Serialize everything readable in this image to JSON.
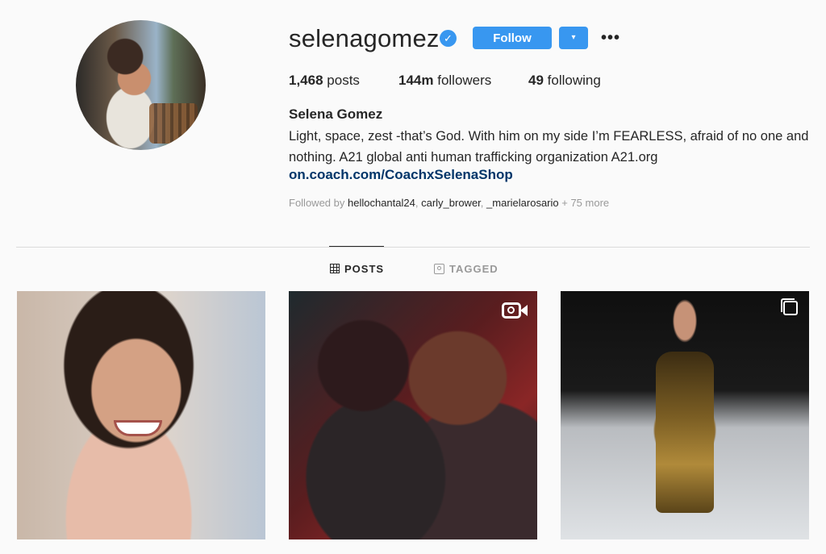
{
  "profile": {
    "username": "selenagomez",
    "verified_mark": "✓",
    "follow_label": "Follow",
    "dropdown_icon": "▾",
    "more_label": "•••",
    "stats": {
      "posts_count": "1,468",
      "posts_label": "posts",
      "followers_count": "144m",
      "followers_label": "followers",
      "following_count": "49",
      "following_label": "following"
    },
    "full_name": "Selena Gomez",
    "bio": "Light, space, zest -that’s God. With him on my side I’m FEARLESS, afraid of no one and nothing. A21 global anti human trafficking organization A21.org",
    "link": "on.coach.com/CoachxSelenaShop",
    "followed_by": {
      "prefix": "Followed by",
      "users": [
        "hellochantal24",
        "carly_brower",
        "_marielarosario"
      ],
      "suffix": "+ 75 more"
    }
  },
  "tabs": {
    "posts": "POSTS",
    "tagged": "TAGGED"
  },
  "posts": [
    {
      "icon": ""
    },
    {
      "icon": "video-icon"
    },
    {
      "icon": "carousel-icon"
    }
  ],
  "colors": {
    "accent": "#3897f0",
    "link": "#003569",
    "muted": "#999999",
    "background": "#fafafa"
  }
}
